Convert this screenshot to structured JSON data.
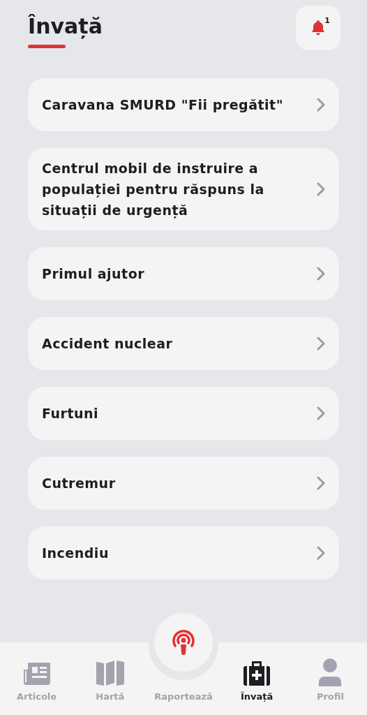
{
  "header": {
    "title": "Învață",
    "notification_count": "1"
  },
  "items": [
    {
      "label": "Caravana SMURD \"Fii pregătit\""
    },
    {
      "label": "Centrul mobil de instruire a populației pentru răspuns la situații de urgență"
    },
    {
      "label": "Primul ajutor"
    },
    {
      "label": "Accident nuclear"
    },
    {
      "label": "Furtuni"
    },
    {
      "label": "Cutremur"
    },
    {
      "label": "Incendiu"
    }
  ],
  "tabs": [
    {
      "kind": "news",
      "label": "Articole",
      "selected": false
    },
    {
      "kind": "map",
      "label": "Hartă",
      "selected": false
    },
    {
      "kind": "report",
      "label": "Raportează",
      "selected": false
    },
    {
      "kind": "kit",
      "label": "Învață",
      "selected": true
    },
    {
      "kind": "profile",
      "label": "Profil",
      "selected": false
    }
  ]
}
